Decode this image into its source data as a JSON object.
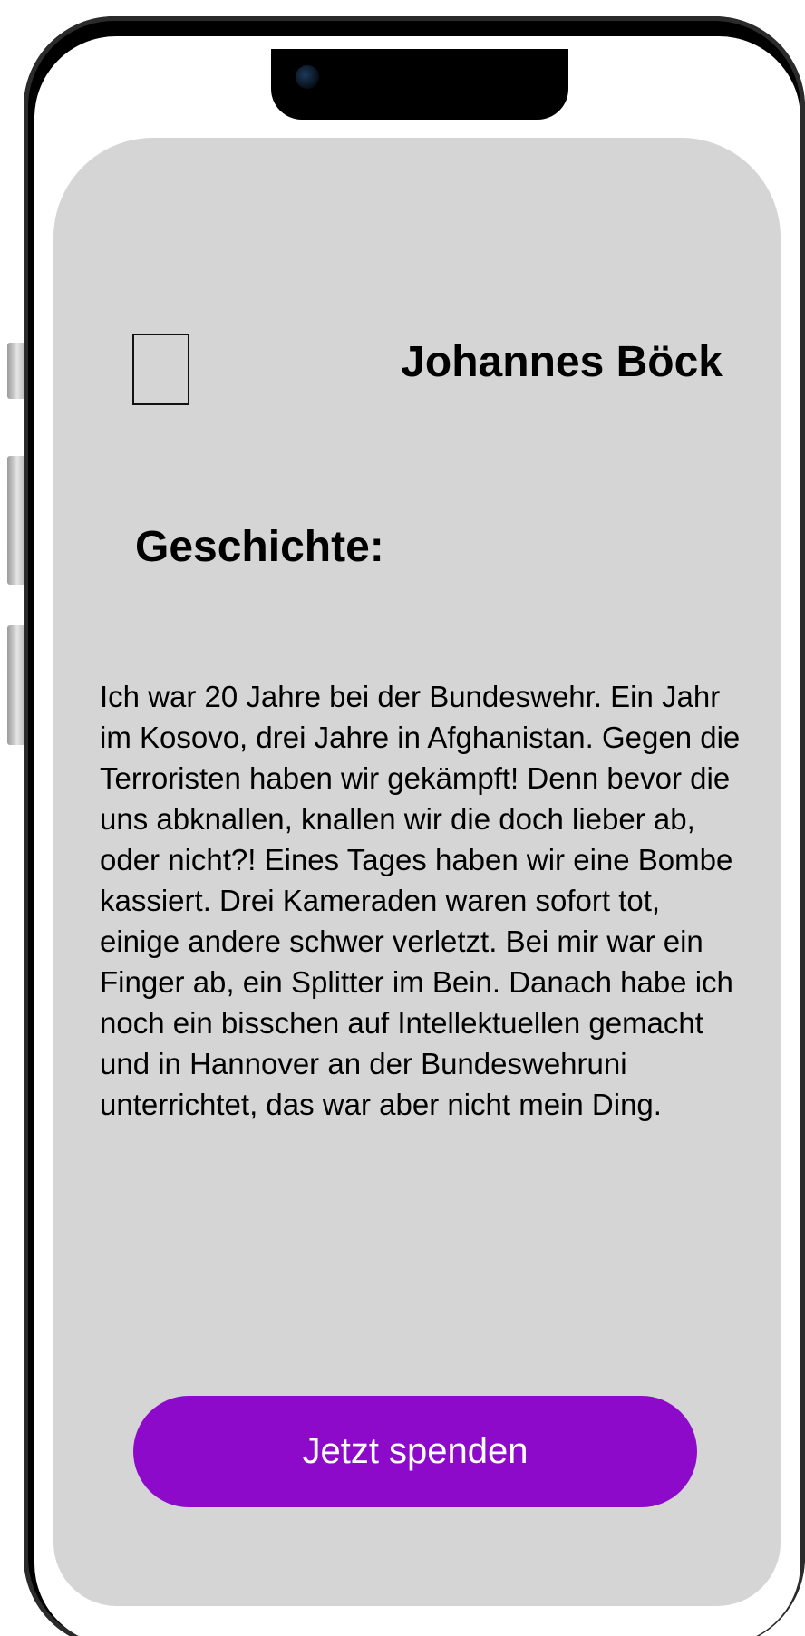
{
  "profile": {
    "name": "Johannes Böck"
  },
  "story": {
    "heading": "Geschichte:",
    "text": "Ich war 20 Jahre bei der Bundeswehr. Ein Jahr im Kosovo, drei Jahre in Afghanistan. Gegen die Terroristen haben wir gekämpft! Denn bevor die uns abknallen, knallen wir die doch lieber ab, oder nicht?! Eines Tages haben wir eine Bombe kassiert. Drei Kameraden waren sofort tot, einige andere schwer verletzt. Bei mir war ein Finger ab, ein Splitter im Bein. Danach habe ich noch ein bisschen auf Intellektuellen gemacht und in Hannover an der Bundeswehruni unterrichtet, das war aber nicht mein Ding."
  },
  "actions": {
    "donate_label": "Jetzt spenden"
  },
  "colors": {
    "screen_background": "#d5d5d5",
    "donate_button": "#8d0acb",
    "donate_text": "#ffffff"
  }
}
